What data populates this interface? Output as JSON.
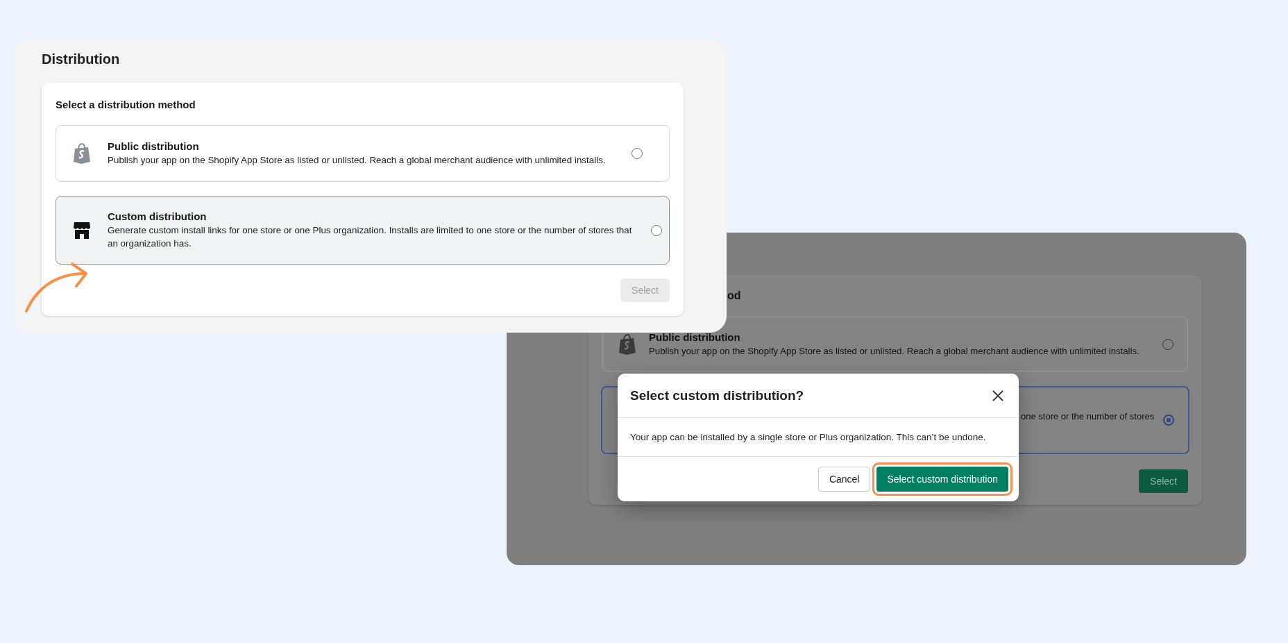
{
  "page_panel": {
    "title": "Distribution",
    "card": {
      "heading": "Select a distribution method",
      "options": [
        {
          "kind": "public",
          "title": "Public distribution",
          "description": "Publish your app on the Shopify App Store as listed or unlisted. Reach a global merchant audience with unlimited installs.",
          "selected": false,
          "highlighted": false
        },
        {
          "kind": "custom",
          "title": "Custom distribution",
          "description": "Generate custom install links for one store or one Plus organization. Installs are limited to one store or the number of stores that an organization has.",
          "selected": false,
          "highlighted": true
        }
      ],
      "button": {
        "label": "Select",
        "disabled": true
      }
    }
  },
  "dialog_panel": {
    "card": {
      "heading": "od",
      "options": [
        {
          "kind": "public",
          "title": "Public distribution",
          "description": "Publish your app on the Shopify App Store as listed or unlisted. Reach a global merchant audience with unlimited installs.",
          "selected": false
        },
        {
          "kind": "custom",
          "description": "one store or the number of stores",
          "selected": true
        }
      ],
      "button": {
        "label": "Select",
        "disabled": false
      }
    },
    "modal": {
      "title": "Select custom distribution?",
      "body": "Your app can be installed by a single store or Plus organization. This can’t be undone.",
      "buttons": [
        {
          "kind": "secondary",
          "label": "Cancel",
          "highlighted": false
        },
        {
          "kind": "primary",
          "label": "Select custom distribution",
          "highlighted": true
        }
      ]
    }
  }
}
